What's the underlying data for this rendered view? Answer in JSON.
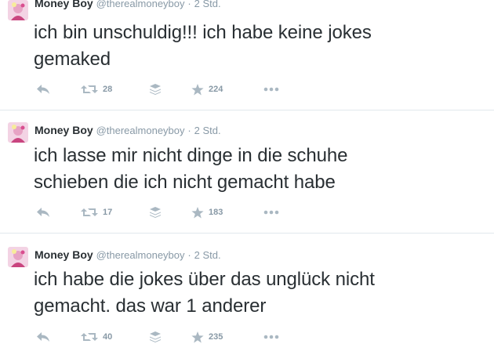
{
  "tweets": [
    {
      "name": "Money Boy",
      "handle": "@therealmoneyboy",
      "separator": "·",
      "time": "2 Std.",
      "text_lines": [
        "ich bin unschuldig!!! ich habe keine jokes",
        "gemaked"
      ],
      "retweets": "28",
      "favorites": "224"
    },
    {
      "name": "Money Boy",
      "handle": "@therealmoneyboy",
      "separator": "·",
      "time": "2 Std.",
      "text_lines": [
        "ich lasse mir nicht dinge in die schuhe",
        "schieben die ich nicht gemacht habe"
      ],
      "retweets": "17",
      "favorites": "183"
    },
    {
      "name": "Money Boy",
      "handle": "@therealmoneyboy",
      "separator": "·",
      "time": "2 Std.",
      "text_lines": [
        "ich habe die jokes über das unglück nicht",
        "gemacht. das war 1 anderer"
      ],
      "retweets": "40",
      "favorites": "235"
    }
  ],
  "icons": {
    "reply": "reply-icon",
    "retweet": "retweet-icon",
    "stack": "buffer-icon",
    "favorite": "star-icon",
    "more": "more-icon"
  },
  "colors": {
    "text": "#292f33",
    "muted": "#8899a6",
    "icon": "#aab8c2",
    "divider": "#e1e8ed"
  }
}
